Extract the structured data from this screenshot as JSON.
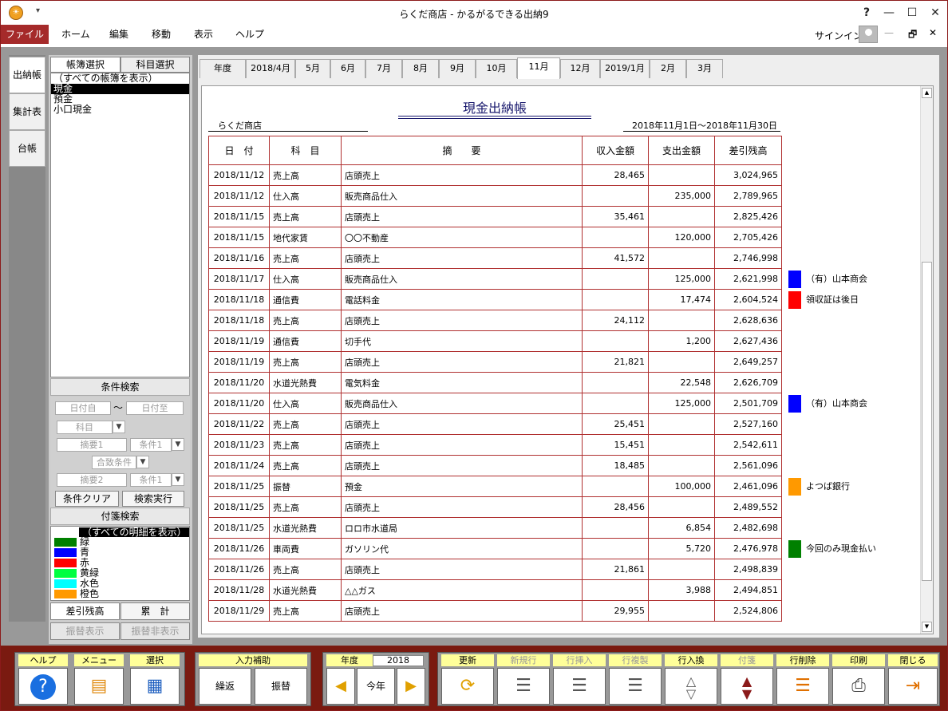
{
  "titlebar": {
    "title": "らくだ商店 - かるがるできる出納9",
    "help": "?",
    "minimize": "—",
    "maximize": "☐",
    "close": "✕"
  },
  "menu": {
    "file": "ファイル",
    "items": [
      "ホーム",
      "編集",
      "移動",
      "表示",
      "ヘルプ"
    ],
    "signin": "サインイン"
  },
  "vtabs": [
    "出納帳",
    "集計表",
    "台帳"
  ],
  "left_panel": {
    "tabs": [
      "帳簿選択",
      "科目選択"
    ],
    "ledgers": [
      "（すべての帳簿を表示）",
      "現金",
      "預金",
      "小口現金"
    ],
    "selected_ledger": 1,
    "condition_title": "条件検索",
    "cond": {
      "date_from": "日付自",
      "tilde": "〜",
      "date_to": "日付至",
      "account": "科目",
      "memo1": "摘要1",
      "cond1": "条件1",
      "match": "合致条件",
      "memo2": "摘要2",
      "cond2": "条件1",
      "clear_btn": "条件クリア",
      "search_btn": "検索実行"
    },
    "tag_title": "付箋検索",
    "tag_all": "（すべての明細を表示）",
    "tags": [
      {
        "label": "緑",
        "color": "#008000"
      },
      {
        "label": "青",
        "color": "#0000ff"
      },
      {
        "label": "赤",
        "color": "#ff0000"
      },
      {
        "label": "黄緑",
        "color": "#00ff40"
      },
      {
        "label": "水色",
        "color": "#00ffff"
      },
      {
        "label": "橙色",
        "color": "#ff9900"
      }
    ],
    "btn_balance": "差引残高",
    "btn_total": "累　計",
    "btn_show_transfer": "振替表示",
    "btn_hide_transfer": "振替非表示"
  },
  "month_tabs": [
    "年度",
    "2018/4月",
    "5月",
    "6月",
    "7月",
    "8月",
    "9月",
    "10月",
    "11月",
    "12月",
    "2019/1月",
    "2月",
    "3月"
  ],
  "active_month": 8,
  "document": {
    "title": "現金出納帳",
    "shop": "らくだ商店",
    "period": "2018年11月1日〜2018年11月30日",
    "headers": [
      "日　付",
      "科　目",
      "摘　　要",
      "収入金額",
      "支出金額",
      "差引残高"
    ],
    "rows": [
      {
        "date": "2018/11/12",
        "account": "売上高",
        "memo": "店頭売上",
        "income": "28,465",
        "expense": "",
        "balance": "3,024,965",
        "tag": "",
        "tag_color": ""
      },
      {
        "date": "2018/11/12",
        "account": "仕入高",
        "memo": "販売商品仕入",
        "income": "",
        "expense": "235,000",
        "balance": "2,789,965",
        "tag": "",
        "tag_color": ""
      },
      {
        "date": "2018/11/15",
        "account": "売上高",
        "memo": "店頭売上",
        "income": "35,461",
        "expense": "",
        "balance": "2,825,426",
        "tag": "",
        "tag_color": ""
      },
      {
        "date": "2018/11/15",
        "account": "地代家賃",
        "memo": "〇〇不動産",
        "income": "",
        "expense": "120,000",
        "balance": "2,705,426",
        "tag": "",
        "tag_color": ""
      },
      {
        "date": "2018/11/16",
        "account": "売上高",
        "memo": "店頭売上",
        "income": "41,572",
        "expense": "",
        "balance": "2,746,998",
        "tag": "",
        "tag_color": ""
      },
      {
        "date": "2018/11/17",
        "account": "仕入高",
        "memo": "販売商品仕入",
        "income": "",
        "expense": "125,000",
        "balance": "2,621,998",
        "tag": "（有）山本商会",
        "tag_color": "#0000ff"
      },
      {
        "date": "2018/11/18",
        "account": "通信費",
        "memo": "電話料金",
        "income": "",
        "expense": "17,474",
        "balance": "2,604,524",
        "tag": "領収証は後日",
        "tag_color": "#ff0000"
      },
      {
        "date": "2018/11/18",
        "account": "売上高",
        "memo": "店頭売上",
        "income": "24,112",
        "expense": "",
        "balance": "2,628,636",
        "tag": "",
        "tag_color": ""
      },
      {
        "date": "2018/11/19",
        "account": "通信費",
        "memo": "切手代",
        "income": "",
        "expense": "1,200",
        "balance": "2,627,436",
        "tag": "",
        "tag_color": ""
      },
      {
        "date": "2018/11/19",
        "account": "売上高",
        "memo": "店頭売上",
        "income": "21,821",
        "expense": "",
        "balance": "2,649,257",
        "tag": "",
        "tag_color": ""
      },
      {
        "date": "2018/11/20",
        "account": "水道光熱費",
        "memo": "電気料金",
        "income": "",
        "expense": "22,548",
        "balance": "2,626,709",
        "tag": "",
        "tag_color": ""
      },
      {
        "date": "2018/11/20",
        "account": "仕入高",
        "memo": "販売商品仕入",
        "income": "",
        "expense": "125,000",
        "balance": "2,501,709",
        "tag": "（有）山本商会",
        "tag_color": "#0000ff"
      },
      {
        "date": "2018/11/22",
        "account": "売上高",
        "memo": "店頭売上",
        "income": "25,451",
        "expense": "",
        "balance": "2,527,160",
        "tag": "",
        "tag_color": ""
      },
      {
        "date": "2018/11/23",
        "account": "売上高",
        "memo": "店頭売上",
        "income": "15,451",
        "expense": "",
        "balance": "2,542,611",
        "tag": "",
        "tag_color": ""
      },
      {
        "date": "2018/11/24",
        "account": "売上高",
        "memo": "店頭売上",
        "income": "18,485",
        "expense": "",
        "balance": "2,561,096",
        "tag": "",
        "tag_color": ""
      },
      {
        "date": "2018/11/25",
        "account": "振替",
        "memo": "預金",
        "income": "",
        "expense": "100,000",
        "balance": "2,461,096",
        "tag": "よつば銀行",
        "tag_color": "#ff9900"
      },
      {
        "date": "2018/11/25",
        "account": "売上高",
        "memo": "店頭売上",
        "income": "28,456",
        "expense": "",
        "balance": "2,489,552",
        "tag": "",
        "tag_color": ""
      },
      {
        "date": "2018/11/25",
        "account": "水道光熱費",
        "memo": "ロロ市水道局",
        "income": "",
        "expense": "6,854",
        "balance": "2,482,698",
        "tag": "",
        "tag_color": ""
      },
      {
        "date": "2018/11/26",
        "account": "車両費",
        "memo": "ガソリン代",
        "income": "",
        "expense": "5,720",
        "balance": "2,476,978",
        "tag": "今回のみ現金払い",
        "tag_color": "#008000"
      },
      {
        "date": "2018/11/26",
        "account": "売上高",
        "memo": "店頭売上",
        "income": "21,861",
        "expense": "",
        "balance": "2,498,839",
        "tag": "",
        "tag_color": ""
      },
      {
        "date": "2018/11/28",
        "account": "水道光熱費",
        "memo": "△△ガス",
        "income": "",
        "expense": "3,988",
        "balance": "2,494,851",
        "tag": "",
        "tag_color": ""
      },
      {
        "date": "2018/11/29",
        "account": "売上高",
        "memo": "店頭売上",
        "income": "29,955",
        "expense": "",
        "balance": "2,524,806",
        "tag": "",
        "tag_color": ""
      }
    ]
  },
  "toolbar": {
    "help": "ヘルプ",
    "menu": "メニュー",
    "select": "選択",
    "input_assist": "入力補助",
    "repeat": "繰返",
    "transfer": "振替",
    "year_label": "年度",
    "year_value": "2018",
    "this_year": "今年",
    "refresh": "更新",
    "new_row": "新規行",
    "insert_row": "行挿入",
    "copy_row": "行複製",
    "swap_row": "行入換",
    "tag": "付箋",
    "delete_row": "行削除",
    "print": "印刷",
    "close": "閉じる"
  }
}
